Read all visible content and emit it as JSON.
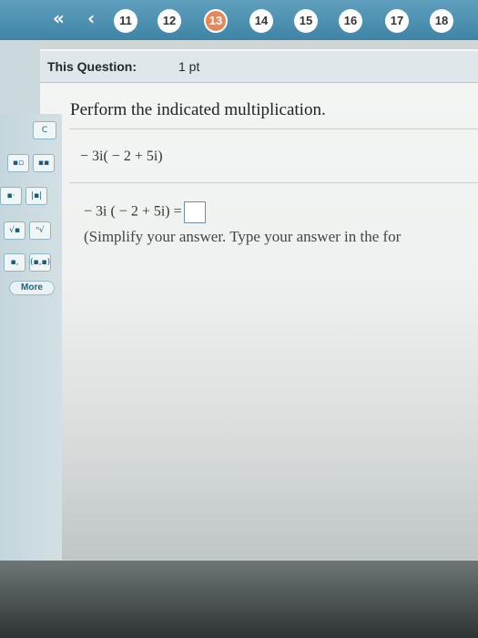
{
  "navigation": {
    "first_label": "«",
    "prev_label": "‹",
    "questions": [
      "11",
      "12",
      "13",
      "14",
      "15",
      "16",
      "17",
      "18"
    ],
    "current": "13"
  },
  "question": {
    "header_label": "This Question:",
    "points": "1 pt",
    "instruction": "Perform the indicated multiplication.",
    "expression": "− 3i( − 2 + 5i)",
    "answer_prefix": "− 3i ( − 2 + 5i) =",
    "answer_value": "",
    "hint": "(Simplify your answer. Type your answer in the for"
  },
  "tools": {
    "more_label": "More"
  },
  "colors": {
    "nav_bar": "#4a8fb0",
    "current_question": "#e8875a"
  }
}
